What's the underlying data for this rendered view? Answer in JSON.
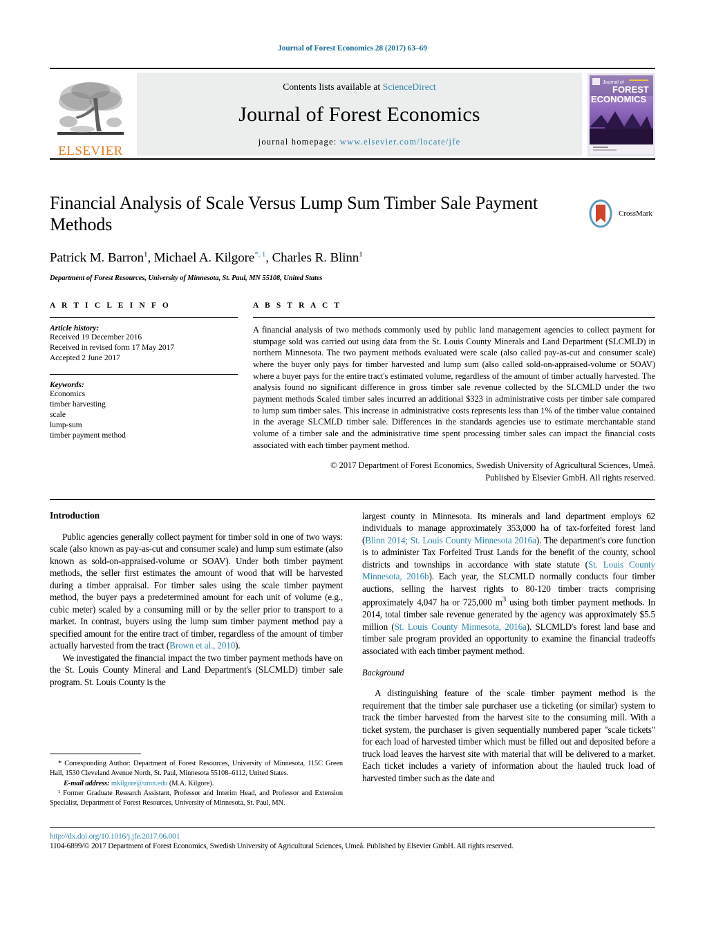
{
  "running_head": "Journal of Forest Economics 28 (2017) 63–69",
  "masthead": {
    "publisher_name": "ELSEVIER",
    "contents_prefix": "Contents lists available at ",
    "contents_link": "ScienceDirect",
    "journal_name": "Journal of Forest Economics",
    "homepage_prefix": "journal homepage: ",
    "homepage_url": "www.elsevier.com/locate/jfe",
    "cover": {
      "line1": "Journal of",
      "line2": "FOREST",
      "line3": "ECONOMICS"
    }
  },
  "title_block": {
    "title": "Financial Analysis of Scale Versus Lump Sum Timber Sale Payment Methods",
    "authors": [
      {
        "name": "Patrick M. Barron",
        "sup": "1",
        "sep": ", "
      },
      {
        "name": "Michael A. Kilgore",
        "sup": "*, 1",
        "sep": ", "
      },
      {
        "name": "Charles R. Blinn",
        "sup": "1",
        "sep": ""
      }
    ],
    "affiliation": "Department of Forest Resources, University of Minnesota, St. Paul, MN 55108, United States",
    "crossmark_label": "CrossMark"
  },
  "article_info": {
    "heading": "A R T I C L E   I N F O",
    "history_label": "Article history:",
    "history": [
      "Received 19 December 2016",
      "Received in revised form 17 May 2017",
      "Accepted 2 June 2017"
    ],
    "keywords_label": "Keywords:",
    "keywords": [
      "Economics",
      "timber harvesting",
      "scale",
      "lump-sum",
      "timber payment method"
    ]
  },
  "abstract": {
    "heading": "A B S T R A C T",
    "text": "A financial analysis of two methods commonly used by public land management agencies to collect payment for stumpage sold was carried out using data from the St. Louis County Minerals and Land Department (SLCMLD) in northern Minnesota. The two payment methods evaluated were scale (also called pay-as-cut and consumer scale) where the buyer only pays for timber harvested and lump sum (also called sold-on-appraised-volume or SOAV) where a buyer pays for the entire tract's estimated volume, regardless of the amount of timber actually harvested. The analysis found no significant difference in gross timber sale revenue collected by the SLCMLD under the two payment methods Scaled timber sales incurred an additional $323 in administrative costs per timber sale compared to lump sum timber sales. This increase in administrative costs represents less than 1% of the timber value contained in the average SLCMLD timber sale. Differences in the standards agencies use to estimate merchantable stand volume of a timber sale and the administrative time spent processing timber sales can impact the financial costs associated with each timber payment method.",
    "copyright_line1": "© 2017 Department of Forest Economics, Swedish University of Agricultural Sciences, Umeå.",
    "copyright_line2": "Published by Elsevier GmbH. All rights reserved."
  },
  "body": {
    "intro_heading": "Introduction",
    "intro_p1": "Public agencies generally collect payment for timber sold in one of two ways: scale (also known as pay-as-cut and consumer scale) and lump sum estimate (also known as sold-on-appraised-volume or SOAV). Under both timber payment methods, the seller first estimates the amount of wood that will be harvested during a timber appraisal. For timber sales using the scale timber payment method, the buyer pays a predetermined amount for each unit of volume (e.g., cubic meter) scaled by a consuming mill or by the seller prior to transport to a market. In contrast, buyers using the lump sum timber payment method pay a specified amount for the entire tract of timber, regardless of the amount of timber actually harvested from the tract (",
    "intro_p1_ref": "Brown et al., 2010",
    "intro_p1_tail": ").",
    "intro_p2": "We investigated the financial impact the two timber payment methods have on the St. Louis County Mineral and Land Department's (SLCMLD) timber sale program. St. Louis County is the",
    "right_p1_a": "largest county in Minnesota. Its minerals and land department employs 62 individuals to manage approximately 353,000 ha of tax-forfeited forest land (",
    "right_p1_ref1": "Blinn 2014; St. Louis County Minnesota 2016a",
    "right_p1_b": "). The department's core function is to administer Tax Forfeited Trust Lands for the benefit of the county, school districts and townships in accordance with state statute (",
    "right_p1_ref2": "St. Louis County Minnesota, 2016b",
    "right_p1_c": "). Each year, the SLCMLD normally conducts four timber auctions, selling the harvest rights to 80-120 timber tracts comprising approximately 4,047 ha or 725,000 m",
    "right_p1_sup": "3",
    "right_p1_d": " using both timber payment methods. In 2014, total timber sale revenue generated by the agency was approximately $5.5 million (",
    "right_p1_ref3": "St. Louis County Minnesota, 2016a",
    "right_p1_e": "). SLCMLD's forest land base and timber sale program provided an opportunity to examine the financial tradeoffs associated with each timber payment method.",
    "background_heading": "Background",
    "background_p1": "A distinguishing feature of the scale timber payment method is the requirement that the timber sale purchaser use a ticketing (or similar) system to track the timber harvested from the harvest site to the consuming mill. With a ticket system, the purchaser is given sequentially numbered paper \"scale tickets\" for each load of harvested timber which must be filled out and deposited before a truck load leaves the harvest site with material that will be delivered to a market. Each ticket includes a variety of information about the hauled truck load of harvested timber such as the date and"
  },
  "footnotes": {
    "corresponding": "* Corresponding Author: Department of Forest Resources, University of Minnesota, 115C Green Hall, 1530 Cleveland Avenue North, St. Paul, Minnesota 55108–6112, United States.",
    "email_label": "E-mail address:",
    "email": "mkilgore@umn.edu",
    "email_suffix": " (M.A. Kilgore).",
    "note1": "¹ Former Graduate Research Assistant, Professor and Interim Head, and Professor and Extension Specialist, Department of Forest Resources, University of Minnesota, St. Paul, MN."
  },
  "footer": {
    "doi": "http://dx.doi.org/10.1016/j.jfe.2017.06.001",
    "issn_line": "1104-6899/© 2017 Department of Forest Economics, Swedish University of Agricultural Sciences, Umeå. Published by Elsevier GmbH. All rights reserved."
  },
  "colors": {
    "link": "#2e86ab",
    "elsevier_orange": "#ef7c1b",
    "masthead_bg": "#eceded"
  }
}
